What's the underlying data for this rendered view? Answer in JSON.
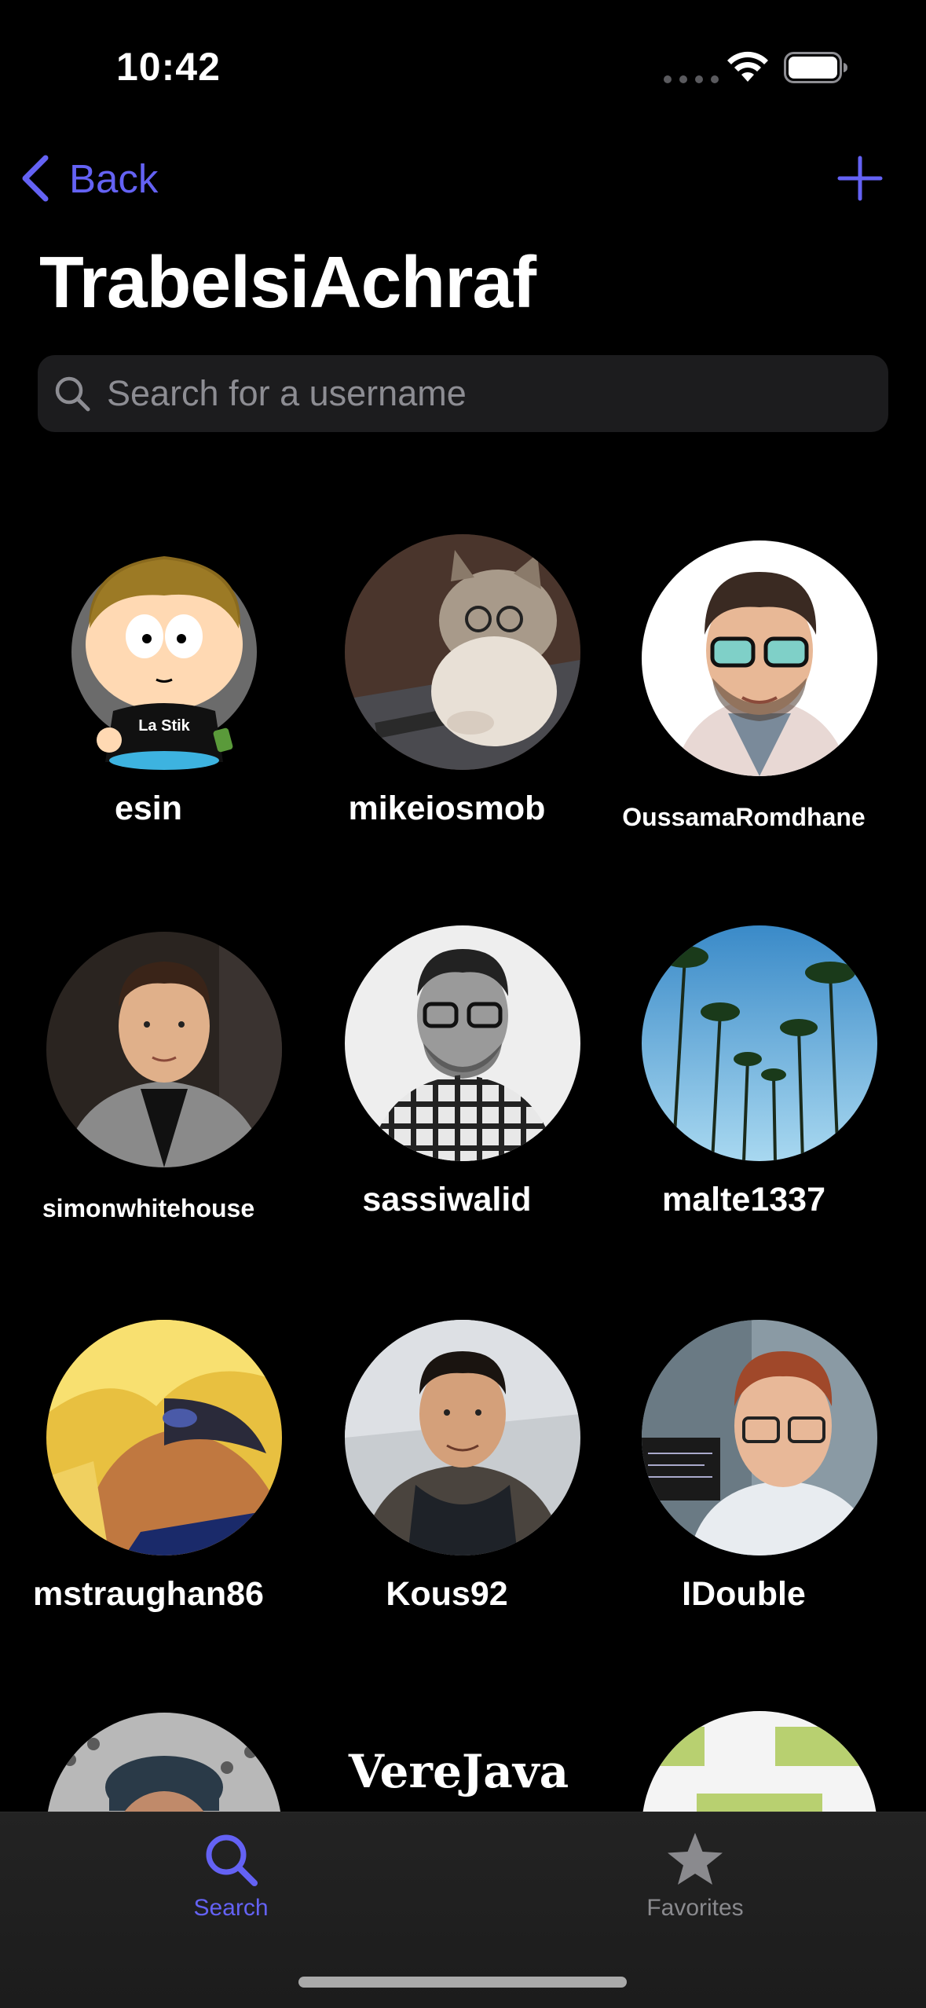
{
  "status_bar": {
    "time": "10:42"
  },
  "nav": {
    "back_label": "Back",
    "back_icon": "chevron-left-icon",
    "add_icon": "plus-icon"
  },
  "title": "TrabelsiAchraf",
  "search": {
    "placeholder": "Search for a username",
    "value": ""
  },
  "users": [
    {
      "username": "esin"
    },
    {
      "username": "mikeiosmob"
    },
    {
      "username": "OussamaRomdhane"
    },
    {
      "username": "simonwhitehouse"
    },
    {
      "username": "sassiwalid"
    },
    {
      "username": "malte1337"
    },
    {
      "username": "mstraughan86"
    },
    {
      "username": "Kous92"
    },
    {
      "username": "IDouble"
    }
  ],
  "partial_row": {
    "avatar_text": "VereJava",
    "badge_text": "La Stik"
  },
  "tab_bar": {
    "tabs": [
      {
        "label": "Search",
        "icon": "search-icon",
        "selected": true
      },
      {
        "label": "Favorites",
        "icon": "star-icon",
        "selected": false
      }
    ]
  },
  "colors": {
    "accent": "#6462f4",
    "background": "#000000",
    "search_field": "#1c1c1e",
    "inactive_tab": "#8a8a8e"
  }
}
